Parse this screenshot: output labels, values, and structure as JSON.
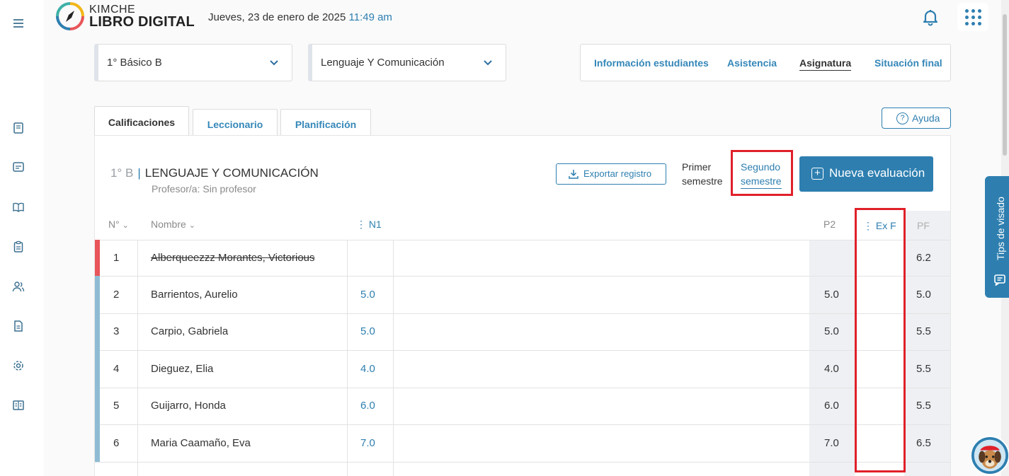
{
  "header": {
    "brand_top": "KIMCHE",
    "brand_bottom": "LIBRO DIGITAL",
    "date": "Jueves, 23 de enero de 2025",
    "time": "11:49 am"
  },
  "filters": {
    "course": "1° Básico B",
    "subject": "Lenguaje Y Comunicación"
  },
  "topnav": [
    "Información estudiantes",
    "Asistencia",
    "Asignatura",
    "Situación final"
  ],
  "tabs": [
    "Calificaciones",
    "Leccionario",
    "Planificación"
  ],
  "help_label": "Ayuda",
  "course_header": {
    "code": "1° B",
    "separator": "|",
    "name": "LENGUAJE Y COMUNICACIÓN",
    "teacher": "Profesor/a: Sin profesor"
  },
  "export_label": "Exportar registro",
  "semester": {
    "first_line1": "Primer",
    "first_line2": "semestre",
    "second_line1": "Segundo",
    "second_line2": "semestre"
  },
  "new_eval_label": "Nueva evaluación",
  "table": {
    "headers": {
      "num": "N°",
      "name": "Nombre",
      "n1": "⋮ N1",
      "p2": "P2",
      "exf": "⋮ Ex F",
      "pf": "PF"
    },
    "rows": [
      {
        "num": "1",
        "name": "Alberqueezzz Morantes, Victorious",
        "n1": "",
        "p2": "",
        "pf": "6.2",
        "marker": "#e8555a",
        "struck": true
      },
      {
        "num": "2",
        "name": "Barrientos, Aurelio",
        "n1": "5.0",
        "p2": "5.0",
        "pf": "5.0",
        "marker": "#8fbcd4"
      },
      {
        "num": "3",
        "name": "Carpio, Gabriela",
        "n1": "5.0",
        "p2": "5.0",
        "pf": "5.5",
        "marker": "#8fbcd4"
      },
      {
        "num": "4",
        "name": "Dieguez, Elia",
        "n1": "4.0",
        "p2": "4.0",
        "pf": "5.5",
        "marker": "#8fbcd4"
      },
      {
        "num": "5",
        "name": "Guijarro, Honda",
        "n1": "6.0",
        "p2": "6.0",
        "pf": "5.5",
        "marker": "#8fbcd4"
      },
      {
        "num": "6",
        "name": "Maria Caamaño, Eva",
        "n1": "7.0",
        "p2": "7.0",
        "pf": "6.5",
        "marker": "#8fbcd4"
      }
    ]
  },
  "side_tab_label": "Tips de visado",
  "colors": {
    "accent": "#2e7fb0",
    "highlight": "#e0202a"
  }
}
